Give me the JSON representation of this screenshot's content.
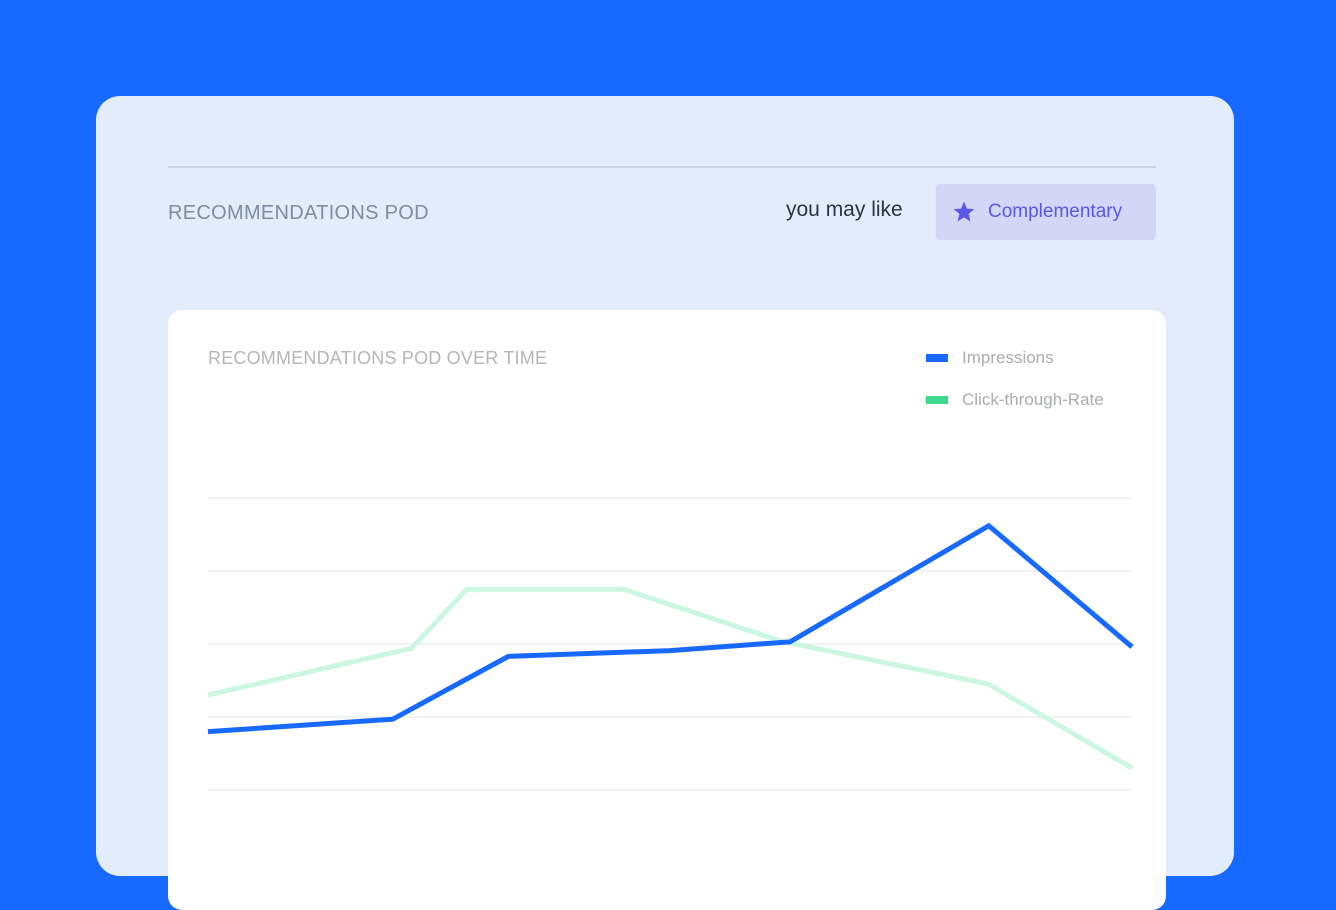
{
  "header": {
    "pod_title": "RECOMMENDATIONS POD",
    "tagline": "you may like",
    "chip_label": "Complementary",
    "chip_icon": "star-icon"
  },
  "colors": {
    "page_background": "#1769FF",
    "card_background": "#E2ECFA",
    "chip_background": "#D2D6F7",
    "chip_accent": "#5B56E3",
    "impressions": "#1769FF",
    "ctr": "#CBF7E2",
    "ctr_legend": "#3DDC8A",
    "gridline": "#ECEEF1"
  },
  "chart_data": {
    "type": "line",
    "title": "RECOMMENDATIONS POD OVER TIME",
    "xlabel": "",
    "ylabel": "",
    "grid": true,
    "legend_position": "top-right",
    "x": [
      0,
      2,
      3.25,
      5,
      6.5,
      8.5,
      10
    ],
    "ylim": [
      0,
      4
    ],
    "series": [
      {
        "name": "Impressions",
        "x": [
          0,
          2,
          3.25,
          5,
          6.3,
          8.45,
          10
        ],
        "values": [
          0.8,
          0.97,
          1.83,
          1.91,
          2.03,
          3.62,
          1.96
        ]
      },
      {
        "name": "Click-through-Rate",
        "x": [
          0,
          2.2,
          2.8,
          4.5,
          6.2,
          8.45,
          10
        ],
        "values": [
          1.3,
          1.94,
          2.75,
          2.75,
          2.04,
          1.45,
          0.3
        ]
      }
    ]
  }
}
